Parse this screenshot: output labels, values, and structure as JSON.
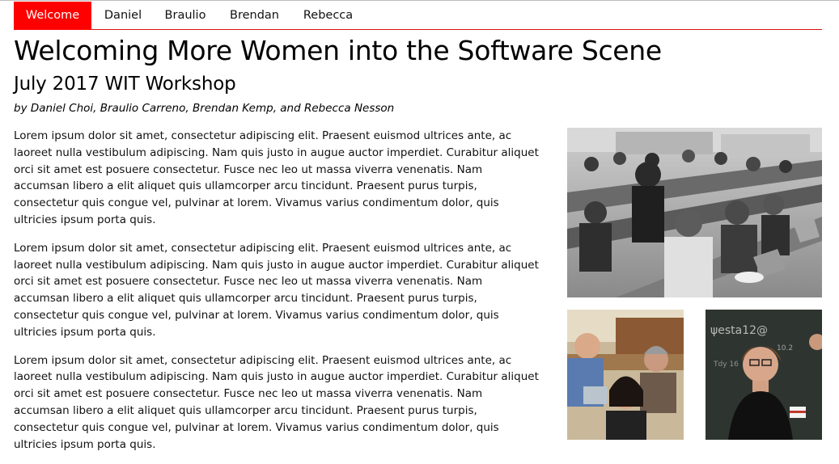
{
  "nav": {
    "tabs": [
      {
        "label": "Welcome",
        "active": true
      },
      {
        "label": "Daniel",
        "active": false
      },
      {
        "label": "Braulio",
        "active": false
      },
      {
        "label": "Brendan",
        "active": false
      },
      {
        "label": "Rebecca",
        "active": false
      }
    ],
    "accent_color": "#ff0000"
  },
  "article": {
    "title": "Welcoming More Women into the Software Scene",
    "subtitle": "July 2017 WIT Workshop",
    "byline": "by Daniel Choi, Braulio Carreno, Brendan Kemp, and Rebecca Nesson",
    "paragraphs": [
      "Lorem ipsum dolor sit amet, consectetur adipiscing elit. Praesent euismod ultrices ante, ac laoreet nulla vestibulum adipiscing. Nam quis justo in augue auctor imperdiet. Curabitur aliquet orci sit amet est posuere consectetur. Fusce nec leo ut massa viverra venenatis. Nam accumsan libero a elit aliquet quis ullamcorper arcu tincidunt. Praesent purus turpis, consectetur quis congue vel, pulvinar at lorem. Vivamus varius condimentum dolor, quis ultricies ipsum porta quis.",
      "Lorem ipsum dolor sit amet, consectetur adipiscing elit. Praesent euismod ultrices ante, ac laoreet nulla vestibulum adipiscing. Nam quis justo in augue auctor imperdiet. Curabitur aliquet orci sit amet est posuere consectetur. Fusce nec leo ut massa viverra venenatis. Nam accumsan libero a elit aliquet quis ullamcorper arcu tincidunt. Praesent purus turpis, consectetur quis congue vel, pulvinar at lorem. Vivamus varius condimentum dolor, quis ultricies ipsum porta quis.",
      "Lorem ipsum dolor sit amet, consectetur adipiscing elit. Praesent euismod ultrices ante, ac laoreet nulla vestibulum adipiscing. Nam quis justo in augue auctor imperdiet. Curabitur aliquet orci sit amet est posuere consectetur. Fusce nec leo ut massa viverra venenatis. Nam accumsan libero a elit aliquet quis ullamcorper arcu tincidunt. Praesent purus turpis, consectetur quis congue vel, pulvinar at lorem. Vivamus varius condimentum dolor, quis ultricies ipsum porta quis."
    ]
  }
}
